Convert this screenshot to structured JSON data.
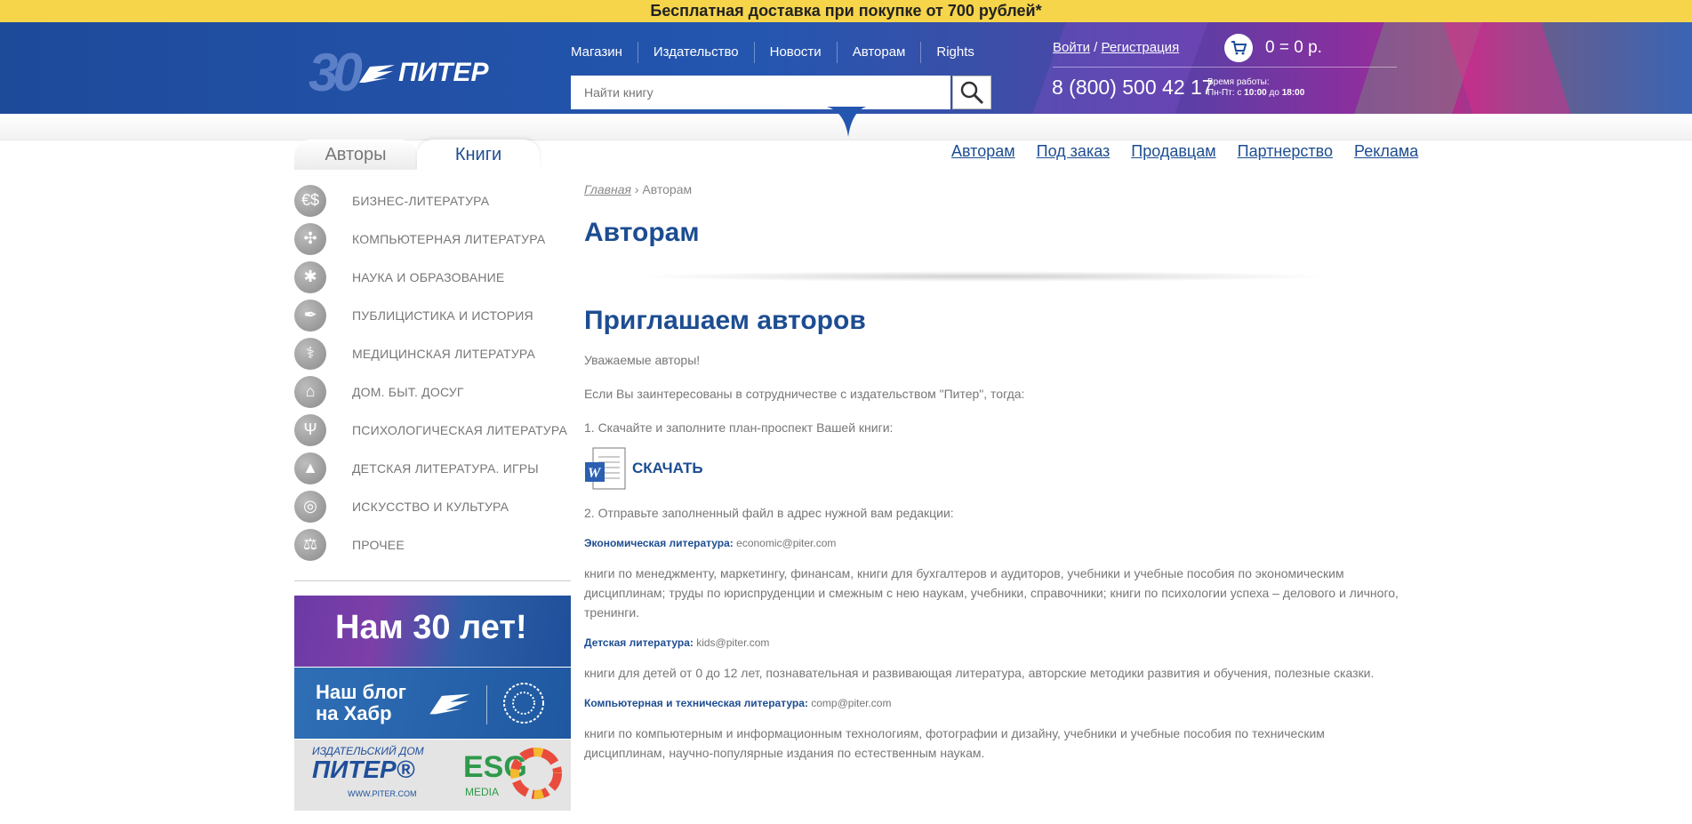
{
  "promo": "Бесплатная доставка при покупке от 700 рублей*",
  "logo": {
    "thirty": "30",
    "name": "ПИТЕР"
  },
  "topnav": [
    "Магазин",
    "Издательство",
    "Новости",
    "Авторам",
    "Rights"
  ],
  "search": {
    "placeholder": "Найти книгу"
  },
  "auth": {
    "login": "Войти",
    "sep": "/",
    "register": "Регистрация"
  },
  "cart": {
    "sum": "0 = 0 р."
  },
  "phone": "8 (800) 500 42 17",
  "worktime": {
    "label": "Время работы:",
    "days": "Пн-Пт: с",
    "from": "10:00",
    "to_word": "до",
    "to": "18:00"
  },
  "side_tabs": {
    "authors": "Авторы",
    "books": "Книги"
  },
  "right_links": [
    "Авторам",
    "Под заказ",
    "Продавцам",
    "Партнерство",
    "Реклама"
  ],
  "categories": [
    {
      "label": "Бизнес-литература",
      "icon": "dollar-icon"
    },
    {
      "label": "Компьютерная литература",
      "icon": "computer-icon"
    },
    {
      "label": "Наука и образование",
      "icon": "vitruvian-icon"
    },
    {
      "label": "Публицистика и история",
      "icon": "quill-icon"
    },
    {
      "label": "Медицинская литература",
      "icon": "caduceus-icon"
    },
    {
      "label": "Дом. Быт. Досуг",
      "icon": "house-icon"
    },
    {
      "label": "Психологическая литература",
      "icon": "psi-icon"
    },
    {
      "label": "Детская литература. Игры",
      "icon": "pyramid-toy-icon"
    },
    {
      "label": "Искусство и культура",
      "icon": "column-icon"
    },
    {
      "label": "Прочее",
      "icon": "scales-icon"
    }
  ],
  "banners": {
    "anniversary": "Нам 30 лет!",
    "blog_line1": "Наш блог",
    "blog_line2": "на Хабр",
    "esg_small": "ИЗДАТЕЛЬСКИЙ ДОМ",
    "esg_name": "ПИТЕР®",
    "esg_site": "WWW.PITER.COM",
    "esg": "ESG",
    "esg_media": "MEDIA"
  },
  "breadcrumb": {
    "home": "Главная",
    "sep": "›",
    "current": "Авторам"
  },
  "page": {
    "title": "Авторам",
    "subtitle": "Приглашаем авторов",
    "greeting": "Уважаемые авторы!",
    "intro": "Если Вы заинтересованы в сотрудничестве с издательством \"Питер\", тогда:",
    "step1": "1. Скачайте и заполните план-проспект Вашей книги:",
    "download": "СКАЧАТЬ",
    "step2": "2. Отправьте заполненный файл в адрес нужной вам редакции:",
    "editions": [
      {
        "name": "Экономическая литература:",
        "email": "economic@piter.com",
        "desc": "книги по менеджменту, маркетингу, финансам, книги для бухгалтеров и аудиторов, учебники и учебные пособия по экономическим дисциплинам; труды по юриспруденции и смежным с нею наукам, учебники, справочники; книги по психологии успеха – делового и личного, тренинги."
      },
      {
        "name": "Детская литература:",
        "email": "kids@piter.com",
        "desc": "книги для детей от 0 до 12 лет, познавательная и развивающая литература, авторские методики развития и обучения, полезные сказки."
      },
      {
        "name": "Компьютерная и техническая литература:",
        "email": "comp@piter.com",
        "desc": "книги по компьютерным и информационным технологиям, фотографии и дизайну, учебники и учебные пособия по техническим дисциплинам, научно-популярные издания по естественным наукам."
      }
    ]
  }
}
